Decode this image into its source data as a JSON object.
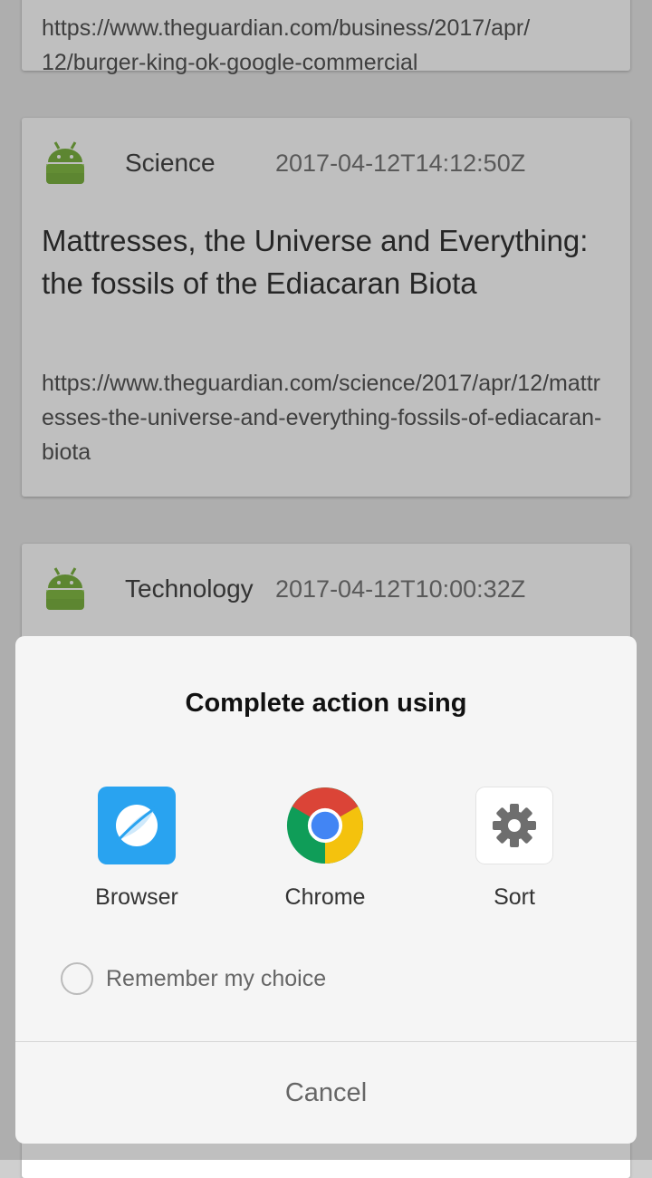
{
  "feed": {
    "cards": [
      {
        "url": "12/burger-king-ok-google-commercial"
      },
      {
        "section": "Science",
        "date": "2017-04-12T14:12:50Z",
        "title": "Mattresses, the Universe and Everything: the fossils of the Ediacaran Biota",
        "url": "https://www.theguardian.com/science/2017/apr/12/mattresses-the-universe-and-everything-fossils-of-ediacaran-biota"
      },
      {
        "section": "Technology",
        "date": "2017-04-12T10:00:32Z"
      }
    ]
  },
  "dialog": {
    "title": "Complete action using",
    "apps": [
      {
        "label": "Browser",
        "icon": "browser-icon"
      },
      {
        "label": "Chrome",
        "icon": "chrome-icon"
      },
      {
        "label": "Sort",
        "icon": "gear-icon"
      }
    ],
    "remember_label": "Remember my choice",
    "cancel_label": "Cancel"
  },
  "colors": {
    "android_green": "#7cb342",
    "browser_blue": "#29a3f0",
    "chrome_red": "#db4437",
    "chrome_yellow": "#f4c20d",
    "chrome_green": "#0f9d58",
    "chrome_blue": "#4285f4"
  }
}
